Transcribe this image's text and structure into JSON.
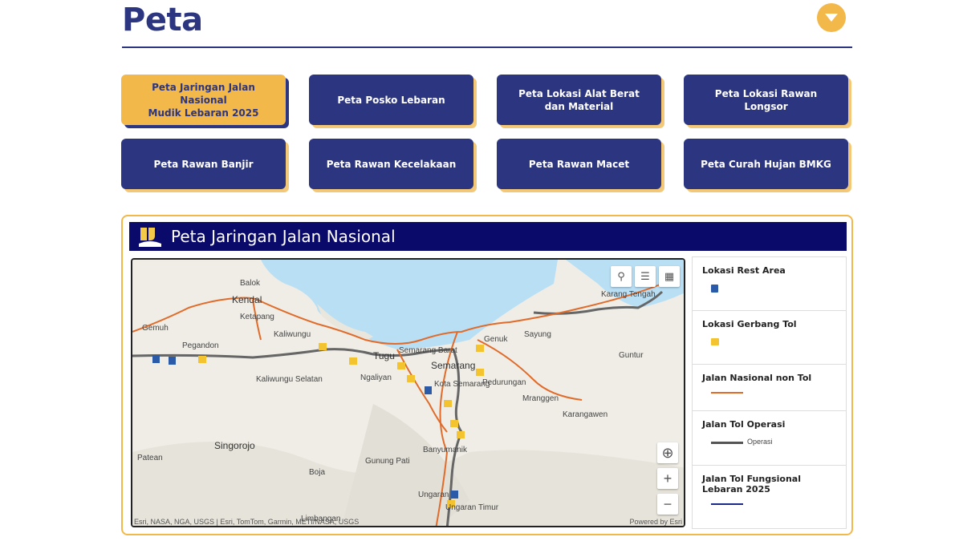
{
  "header": {
    "title": "Peta",
    "toggle_icon": "chevron-down-icon"
  },
  "buttons": [
    {
      "label": "Peta Jaringan Jalan Nasional\nMudik Lebaran 2025",
      "active": true
    },
    {
      "label": "Peta Posko Lebaran",
      "active": false
    },
    {
      "label": "Peta Lokasi Alat Berat\ndan Material",
      "active": false
    },
    {
      "label": "Peta Lokasi Rawan Longsor",
      "active": false
    },
    {
      "label": "Peta Rawan Banjir",
      "active": false
    },
    {
      "label": "Peta Rawan Kecelakaan",
      "active": false
    },
    {
      "label": "Peta Rawan Macet",
      "active": false
    },
    {
      "label": "Peta Curah Hujan BMKG",
      "active": false
    }
  ],
  "panel": {
    "title": "Peta Jaringan Jalan Nasional",
    "attribution": "Esri, NASA, NGA, USGS | Esri, TomTom, Garmin, METI/NASA, USGS",
    "powered_by": "Powered by Esri",
    "place_labels": [
      "Balok",
      "Kendal",
      "Ketapang",
      "Gemuh",
      "Kaliwungu",
      "Pegandon",
      "Kaliwungu Selatan",
      "Tugu",
      "Semarang Barat",
      "Semarang",
      "Ngaliyan",
      "Kota Semarang",
      "Genuk",
      "Sayung",
      "Karang Tengah",
      "Pedurungan",
      "Mranggen",
      "Guntur",
      "Karangawen",
      "Banyumanik",
      "Gunung Pati",
      "Singorojo",
      "Patean",
      "Boja",
      "Ungaran",
      "Ungaran Timur",
      "Limbangan"
    ]
  },
  "legend": [
    {
      "title": "Lokasi Rest Area",
      "symbol": "rest-area"
    },
    {
      "title": "Lokasi Gerbang Tol",
      "symbol": "toll-gate"
    },
    {
      "title": "Jalan Nasional non Tol",
      "symbol": "line",
      "color": "#e06b2a"
    },
    {
      "title": "Jalan Tol Operasi",
      "symbol": "line",
      "color": "#555555",
      "sublabel": "Operasi"
    },
    {
      "title": "Jalan Tol Fungsional Lebaran 2025",
      "symbol": "line",
      "color": "#1a2a8a"
    }
  ],
  "colors": {
    "navy": "#2c3580",
    "gold": "#f3b84a",
    "header_bg": "#0a0a6b",
    "sea": "#b9dff5",
    "road": "#e06b2a",
    "toll": "#555555"
  }
}
